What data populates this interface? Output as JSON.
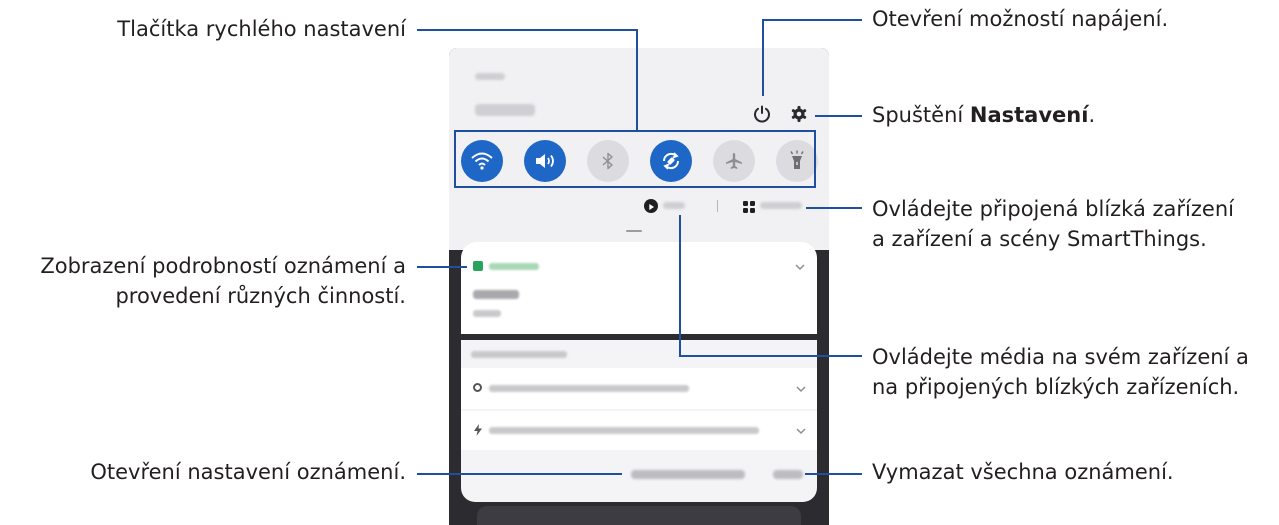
{
  "labels": {
    "quick_settings": "Tlačítka rychlého nastavení",
    "power_options": "Otevření možností napájení.",
    "settings_prefix": "Spuštění ",
    "settings_bold": "Nastavení",
    "settings_suffix": ".",
    "devices_line1": "Ovládejte připojená blízká zařízení",
    "devices_line2": "a zařízení a scény SmartThings.",
    "notif_details_line1": "Zobrazení podrobností oznámení a",
    "notif_details_line2": "provedení různých činností.",
    "media_line1": "Ovládejte média na svém zařízení a",
    "media_line2": "na připojených blízkých zařízeních.",
    "notif_settings": "Otevření nastavení oznámení.",
    "clear_all": "Vymazat všechna oznámení."
  },
  "colors": {
    "callout_line": "#1f4fa0",
    "toggle_on": "#1e67c6",
    "toggle_off": "#dcdce0",
    "calendar_green": "#2aa45a"
  },
  "quick_settings": [
    {
      "icon": "wifi-icon",
      "state": "on"
    },
    {
      "icon": "sound-icon",
      "state": "on"
    },
    {
      "icon": "bluetooth-icon",
      "state": "off"
    },
    {
      "icon": "auto-rotate-icon",
      "state": "on"
    },
    {
      "icon": "airplane-icon",
      "state": "off"
    },
    {
      "icon": "flashlight-icon",
      "state": "off"
    }
  ]
}
